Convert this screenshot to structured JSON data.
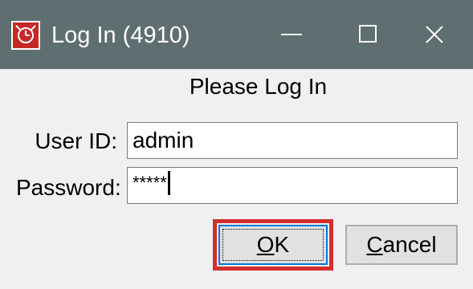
{
  "window": {
    "title": "Log In (4910)",
    "icon": "app-clock-icon",
    "controls": {
      "minimize": "minimize-icon",
      "maximize": "maximize-icon",
      "close": "close-icon"
    }
  },
  "dialog": {
    "header": "Please Log In",
    "user_label": "User ID:",
    "user_value": "admin",
    "password_label": "Password:",
    "password_value": "*****",
    "ok_mnemonic": "O",
    "ok_rest": "K",
    "cancel_mnemonic": "C",
    "cancel_rest": "ancel"
  },
  "colors": {
    "titlebar": "#5f6e70",
    "highlight": "#d32f2f",
    "icon": "#c62828"
  }
}
